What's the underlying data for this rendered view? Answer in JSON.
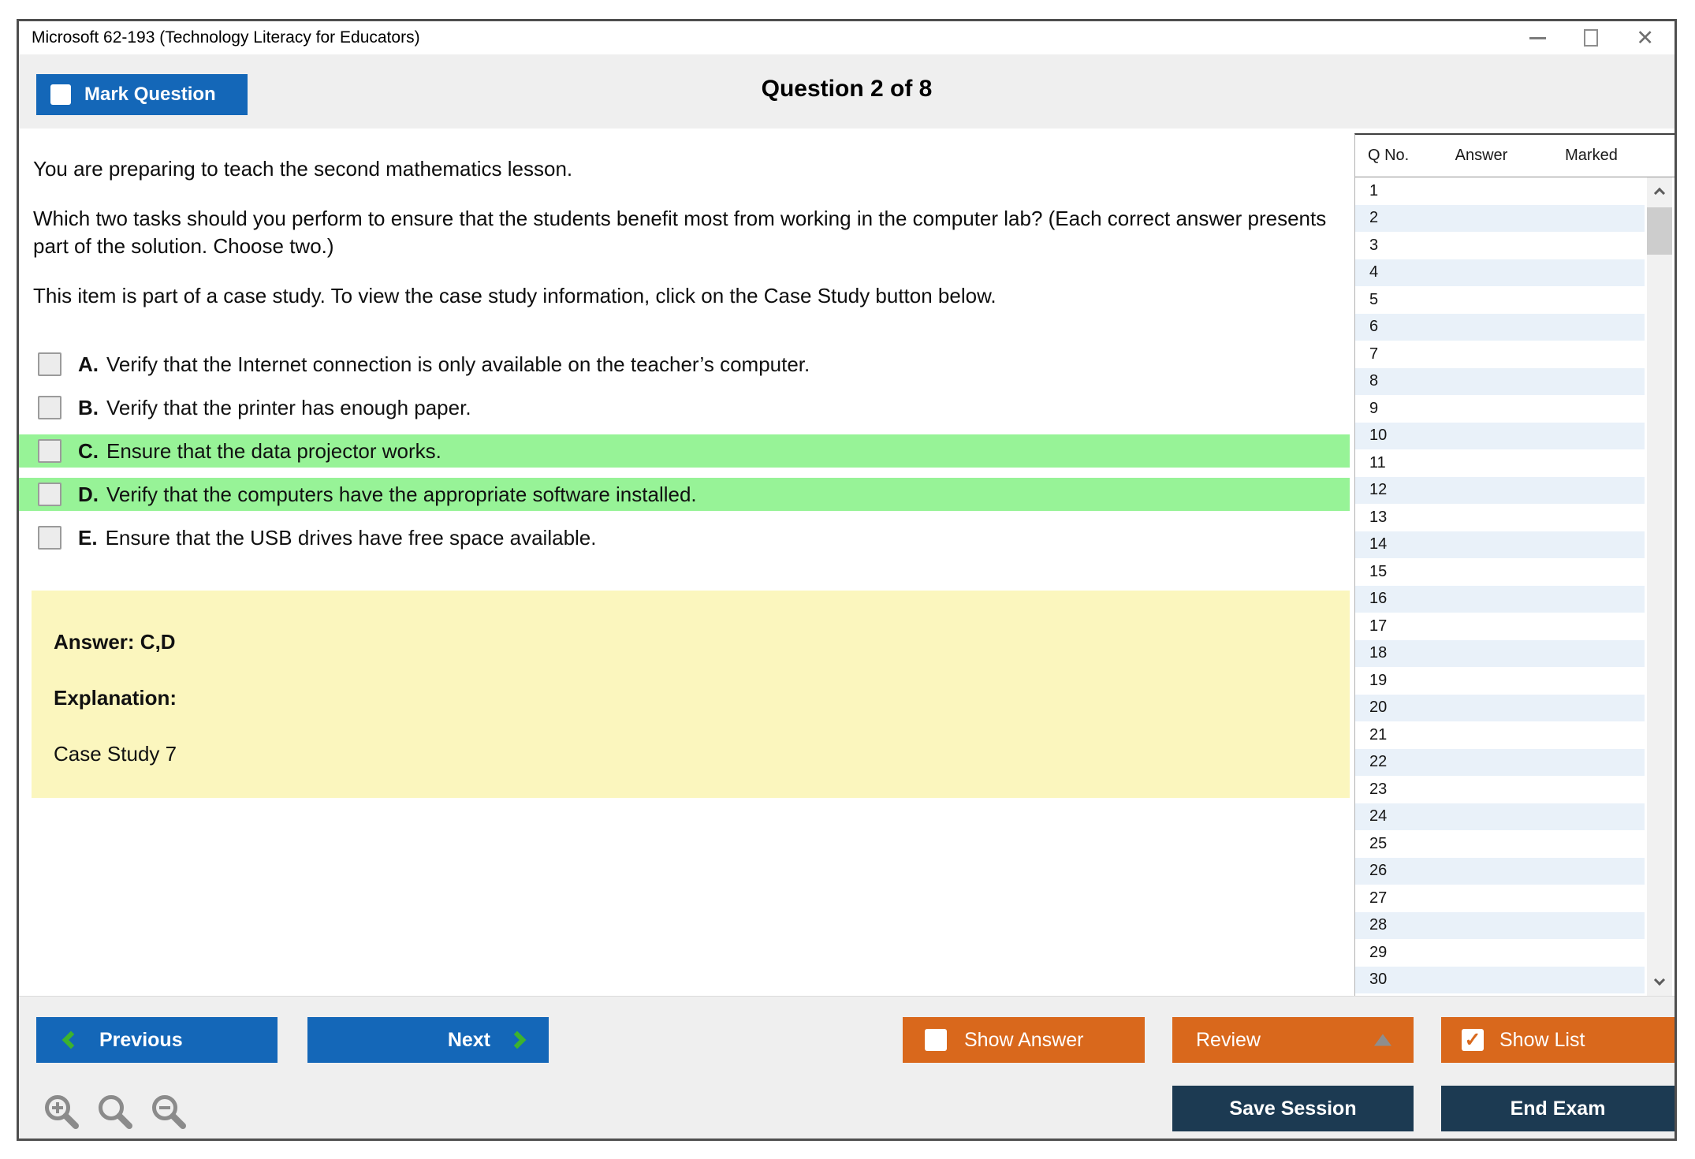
{
  "window": {
    "title": "Microsoft 62-193 (Technology Literacy for Educators)"
  },
  "header": {
    "mark_question": "Mark Question",
    "question_counter": "Question 2 of 8"
  },
  "question": {
    "paragraphs": [
      "You are preparing to teach the second mathematics lesson.",
      "Which two tasks should you perform to ensure that the students benefit most from working in the computer lab? (Each correct answer presents part of the solution. Choose two.)",
      "This item is part of a case study. To view the case study information, click on the Case Study button below."
    ],
    "options": [
      {
        "letter": "A.",
        "text": "Verify that the Internet connection is only available on the teacher’s computer.",
        "highlighted": false
      },
      {
        "letter": "B.",
        "text": "Verify that the printer has enough paper.",
        "highlighted": false
      },
      {
        "letter": "C.",
        "text": "Ensure that the data projector works.",
        "highlighted": true
      },
      {
        "letter": "D.",
        "text": "Verify that the computers have the appropriate software installed.",
        "highlighted": true
      },
      {
        "letter": "E.",
        "text": "Ensure that the USB drives have free space available.",
        "highlighted": false
      }
    ],
    "answer_box": {
      "answer": "Answer: C,D",
      "explanation_label": "Explanation:",
      "explanation": "Case Study 7"
    }
  },
  "sidebar": {
    "columns": {
      "q_no": "Q No.",
      "answer": "Answer",
      "marked": "Marked"
    },
    "rows": [
      "1",
      "2",
      "3",
      "4",
      "5",
      "6",
      "7",
      "8",
      "9",
      "10",
      "11",
      "12",
      "13",
      "14",
      "15",
      "16",
      "17",
      "18",
      "19",
      "20",
      "21",
      "22",
      "23",
      "24",
      "25",
      "26",
      "27",
      "28",
      "29",
      "30"
    ]
  },
  "toolbar": {
    "previous": "Previous",
    "next": "Next",
    "show_answer": "Show Answer",
    "review": "Review",
    "show_list": "Show List",
    "save_session": "Save Session",
    "end_exam": "End Exam"
  },
  "icons": {
    "close": "✕",
    "check": "✓"
  },
  "colors": {
    "accent_blue": "#1467b8",
    "accent_orange": "#d9681c",
    "navy_button": "#1c3a52",
    "highlight_green": "#97f397",
    "explanation_yellow": "#fbf6be",
    "nav_chevron_green": "#3db32e",
    "header_gray": "#efefef",
    "alt_row_blue": "#e9f1f9"
  }
}
